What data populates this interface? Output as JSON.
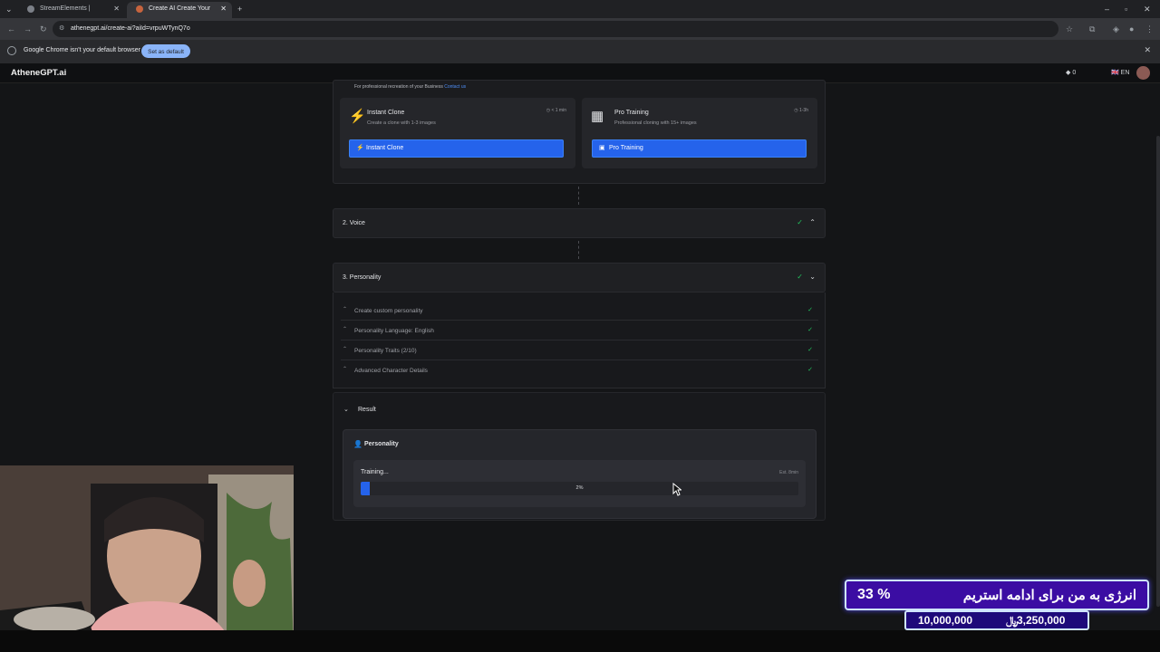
{
  "browser": {
    "tabs": [
      {
        "title": "StreamElements | AtheneAlert...",
        "active": false
      },
      {
        "title": "Create AI Create Your Sentient...",
        "active": true
      }
    ],
    "url": "athenegpt.ai/create-ai?aiId=vrpuWTynQ7o",
    "default_notice": "Google Chrome isn't your default browser",
    "set_default_label": "Set as default"
  },
  "app": {
    "logo": "AtheneGPT.ai",
    "credits": "0",
    "language": "EN"
  },
  "clone": {
    "pro_note": "For professional recreation of your Business",
    "contact_label": "Contact us",
    "instant": {
      "title": "Instant Clone",
      "subtitle": "Create a clone with 1-3 images",
      "time": "< 1 min",
      "button": "Instant Clone",
      "icon": "lightning-icon"
    },
    "pro": {
      "title": "Pro Training",
      "subtitle": "Professional cloning with 15+ images",
      "time": "1-3h",
      "button": "Pro Training",
      "icon": "image-icon"
    }
  },
  "sections": {
    "voice": {
      "label": "2. Voice"
    },
    "personality": {
      "label": "3. Personality",
      "items": [
        {
          "label": "Create custom personality"
        },
        {
          "label": "Personality Language: English"
        },
        {
          "label": "Personality Traits (2/10)"
        },
        {
          "label": "Advanced Character Details"
        }
      ]
    }
  },
  "result": {
    "label": "Result",
    "card_title": "Personality",
    "status": "Training...",
    "estimate": "Est. 8min",
    "progress_percent": 2,
    "progress_label": "2%"
  },
  "overlay": {
    "percent": "33 %",
    "message": "انرژی به من برای ادامه استریم",
    "goal": "10,000,000",
    "current": "3,250,000",
    "currency_symbol": "﷼"
  },
  "colors": {
    "accent_blue": "#2563eb",
    "check_green": "#22c55e",
    "overlay_purple": "#3b0da3"
  }
}
